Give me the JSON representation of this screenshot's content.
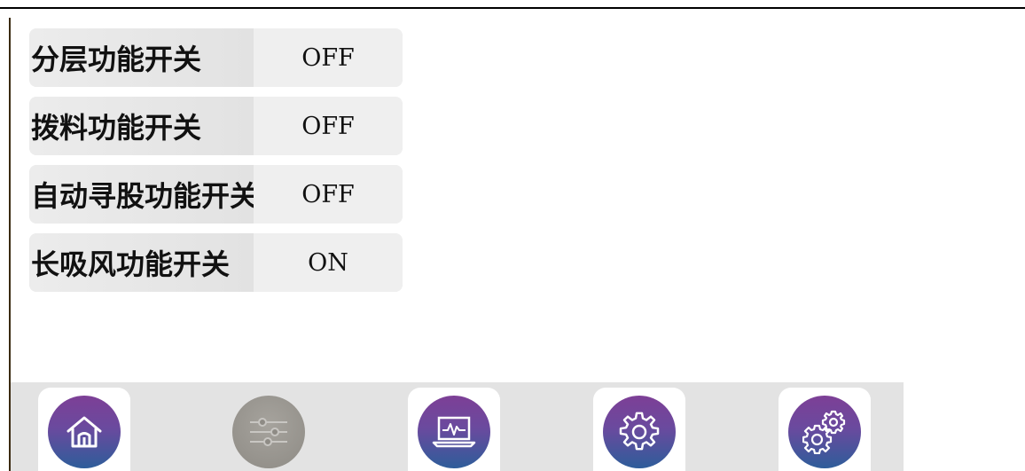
{
  "settings": {
    "rows": [
      {
        "label": "分层功能开关",
        "value": "OFF"
      },
      {
        "label": "拨料功能开关",
        "value": "OFF"
      },
      {
        "label": "自动寻股功能开关",
        "value": "OFF"
      },
      {
        "label": "长吸风功能开关",
        "value": "ON"
      }
    ]
  },
  "navbar": {
    "buttons": [
      {
        "icon": "home-icon",
        "enabled": true
      },
      {
        "icon": "sliders-icon",
        "enabled": false
      },
      {
        "icon": "monitor-icon",
        "enabled": true
      },
      {
        "icon": "gear-icon",
        "enabled": true
      },
      {
        "icon": "gears-icon",
        "enabled": true
      }
    ]
  },
  "colors": {
    "nav_gradient_top": "#7d3f96",
    "nav_gradient_bottom": "#2e5d9a",
    "disabled_button": "#8e8b85",
    "row_background": "#ececec",
    "navbar_background": "#e3e3e3"
  }
}
